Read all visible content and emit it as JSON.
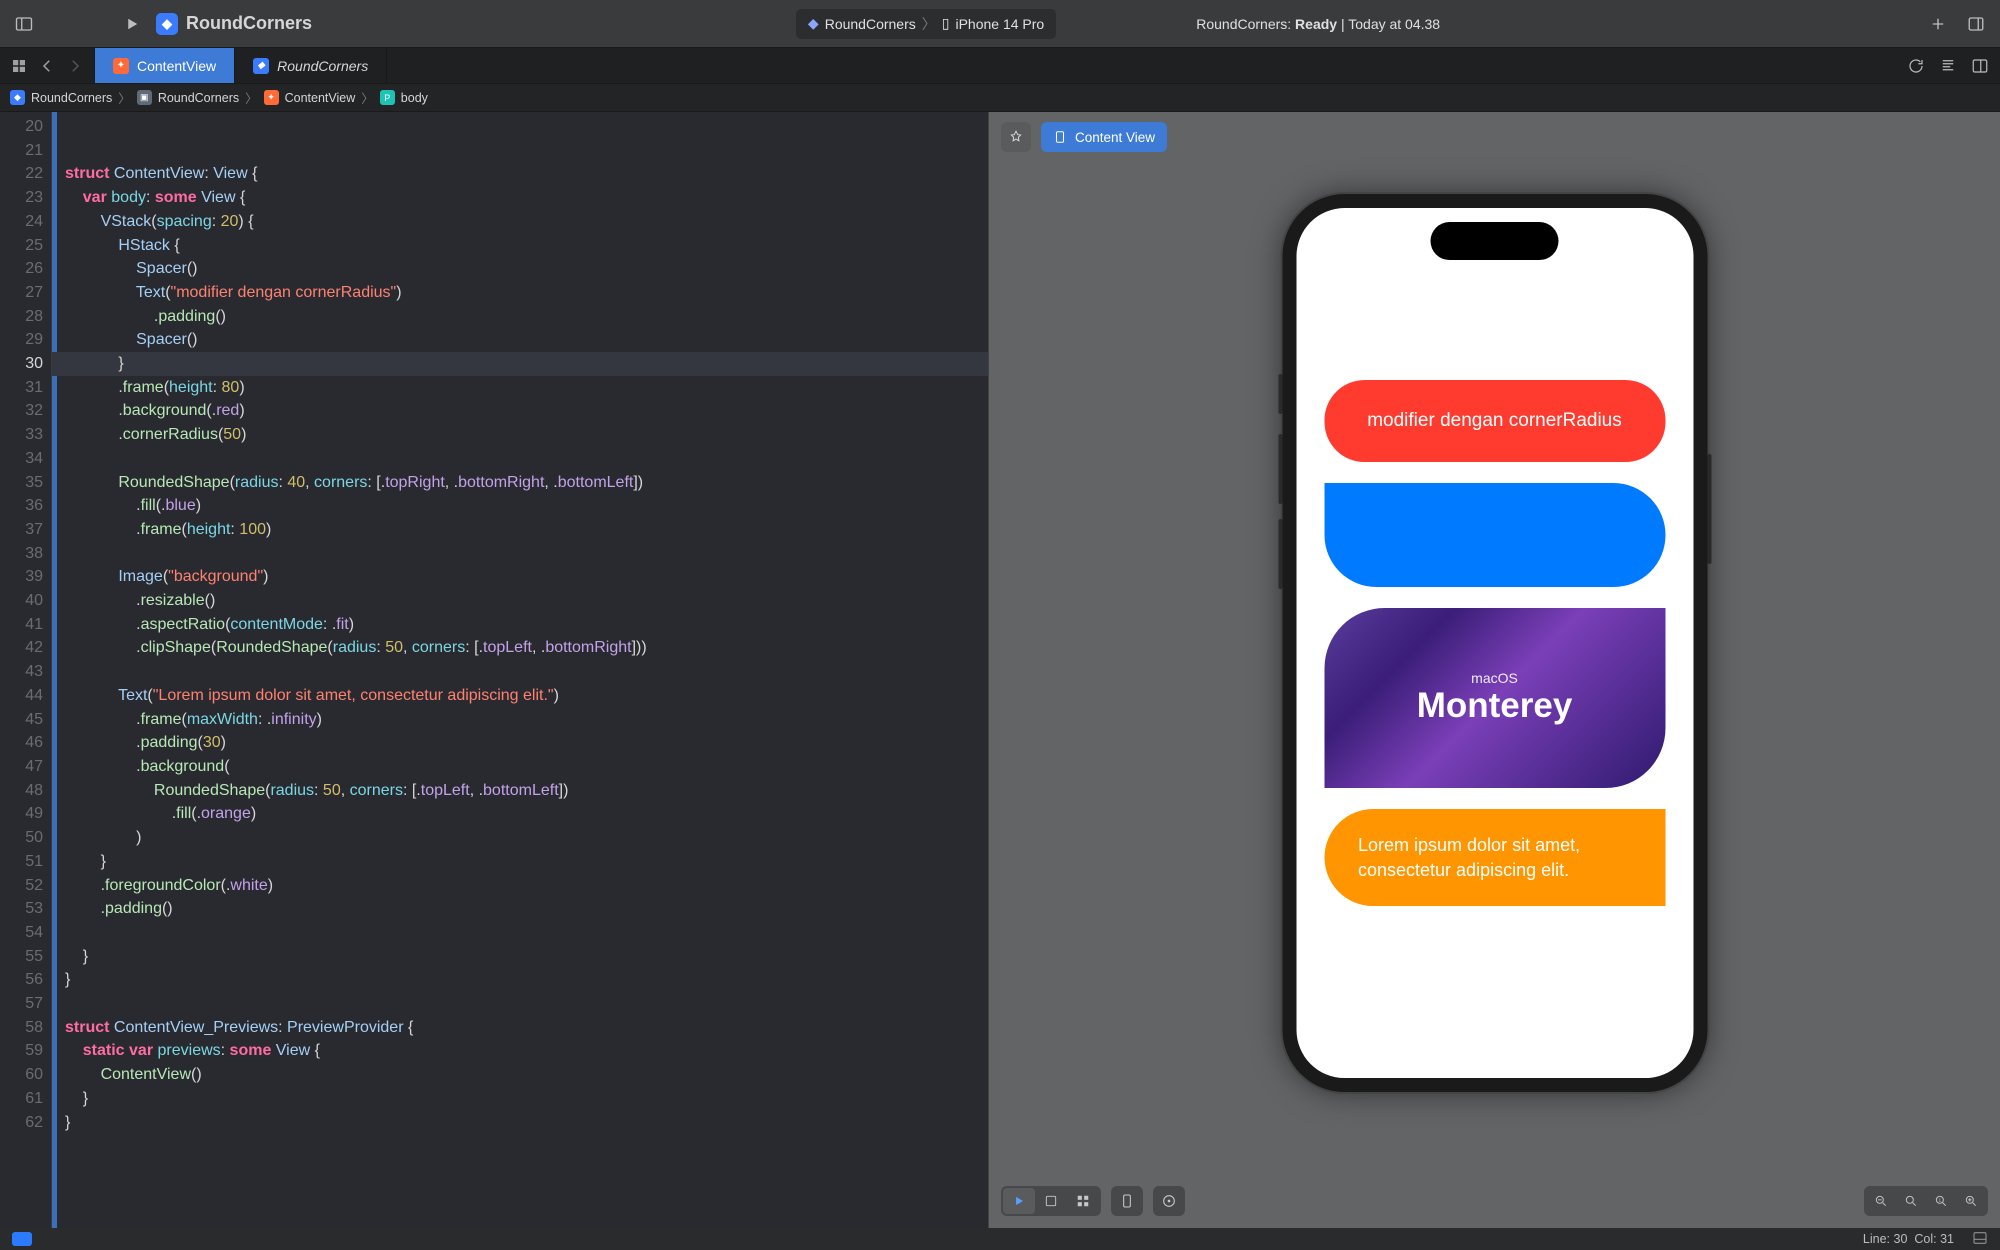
{
  "toolbar": {
    "project_name": "RoundCorners",
    "scheme_target": "RoundCorners",
    "scheme_device": "iPhone 14 Pro",
    "status_prefix": "RoundCorners:",
    "status_state": "Ready",
    "status_suffix": "| Today at 04.38"
  },
  "tabs": [
    {
      "label": "ContentView",
      "icon": "swift",
      "active": true
    },
    {
      "label": "RoundCorners",
      "icon": "proj",
      "active": false
    }
  ],
  "breadcrumb": {
    "items": [
      "RoundCorners",
      "RoundCorners",
      "ContentView",
      "body"
    ]
  },
  "editor": {
    "first_line": 20,
    "current_line": 30,
    "lines_count": 43
  },
  "preview": {
    "chip_label": "Content View",
    "red_text": "modifier dengan cornerRadius",
    "macos_sub": "macOS",
    "macos_title": "Monterey",
    "orange_text": "Lorem ipsum dolor sit amet, consectetur adipiscing elit."
  },
  "status": {
    "line_label": "Line:",
    "line_value": "30",
    "col_label": "Col:",
    "col_value": "31"
  },
  "code_tokens": {
    "struct": "struct",
    "var": "var",
    "static": "static",
    "some": "some",
    "ContentView": "ContentView",
    "View": "View",
    "body": "body",
    "VStack": "VStack",
    "HStack": "HStack",
    "Spacer": "Spacer",
    "Text": "Text",
    "Image": "Image",
    "RoundedShape": "RoundedShape",
    "spacing": "spacing",
    "height": "height",
    "radius": "radius",
    "corners": "corners",
    "maxWidth": "maxWidth",
    "contentMode": "contentMode",
    "padding": "padding",
    "frame": "frame",
    "background": "background",
    "cornerRadius": "cornerRadius",
    "fill": "fill",
    "resizable": "resizable",
    "aspectRatio": "aspectRatio",
    "clipShape": "clipShape",
    "foregroundColor": "foregroundColor",
    "previews": "previews",
    "PreviewProvider": "PreviewProvider",
    "ContentView_Previews": "ContentView_Previews",
    "str_modifier": "\"modifier dengan cornerRadius\"",
    "str_bg": "\"background\"",
    "str_lorem": "\"Lorem ipsum dolor sit amet, consectetur adipiscing elit.\"",
    "n20": "20",
    "n40": "40",
    "n50": "50",
    "n80": "80",
    "n100": "100",
    "n30": "30",
    "red": "red",
    "blue": "blue",
    "white": "white",
    "orange": "orange",
    "topRight": "topRight",
    "bottomRight": "bottomRight",
    "bottomLeft": "bottomLeft",
    "topLeft": "topLeft",
    "infinity": "infinity",
    "fit": "fit"
  }
}
